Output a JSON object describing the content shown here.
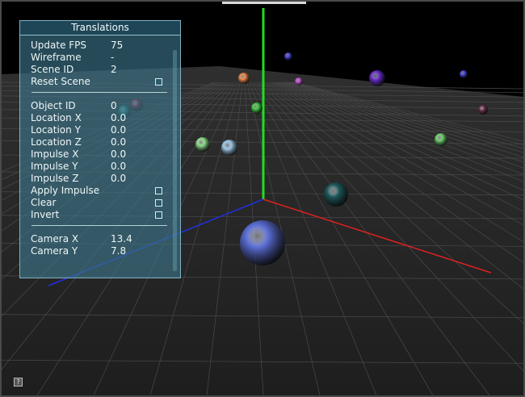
{
  "panel": {
    "title": "Translations",
    "rows": [
      {
        "label": "Update FPS",
        "value": "75"
      },
      {
        "label": "Wireframe",
        "value": "-"
      },
      {
        "label": "Scene ID",
        "value": "2"
      },
      {
        "label": "Reset Scene",
        "checkbox": true
      },
      {
        "label": "Object ID",
        "value": "0"
      },
      {
        "label": "Location X",
        "value": "0.0"
      },
      {
        "label": "Location Y",
        "value": "0.0"
      },
      {
        "label": "Location Z",
        "value": "0.0"
      },
      {
        "label": "Impulse X",
        "value": "0.0"
      },
      {
        "label": "Impulse Y",
        "value": "0.0"
      },
      {
        "label": "Impulse Z",
        "value": "0.0"
      },
      {
        "label": "Apply Impulse",
        "checkbox": true
      },
      {
        "label": "Clear",
        "checkbox": true
      },
      {
        "label": "Invert",
        "checkbox": true
      },
      {
        "label": "Camera X",
        "value": "13.4"
      },
      {
        "label": "Camera Y",
        "value": "7.8"
      }
    ]
  },
  "help_glyph": "?",
  "colors": {
    "x_axis": "#e02020",
    "y_axis": "#22dd22",
    "z_axis": "#2030e0",
    "panel_bg": "#3e788c",
    "floor_grid": "#4a4a4a"
  },
  "spheres": [
    {
      "color": "#5c6fd8"
    },
    {
      "color": "#1d5a5e"
    },
    {
      "color": "#9cc8e8"
    },
    {
      "color": "#8ee08c"
    },
    {
      "color": "#6fd06f"
    },
    {
      "color": "#3fcf3f"
    },
    {
      "color": "#f08a4a"
    },
    {
      "color": "#c050d0"
    },
    {
      "color": "#6a2fd0"
    },
    {
      "color": "#4a45e0"
    },
    {
      "color": "#4a45e0"
    },
    {
      "color": "#6a2f50"
    },
    {
      "color": "#8a2040"
    },
    {
      "color": "#1e7a70"
    }
  ]
}
